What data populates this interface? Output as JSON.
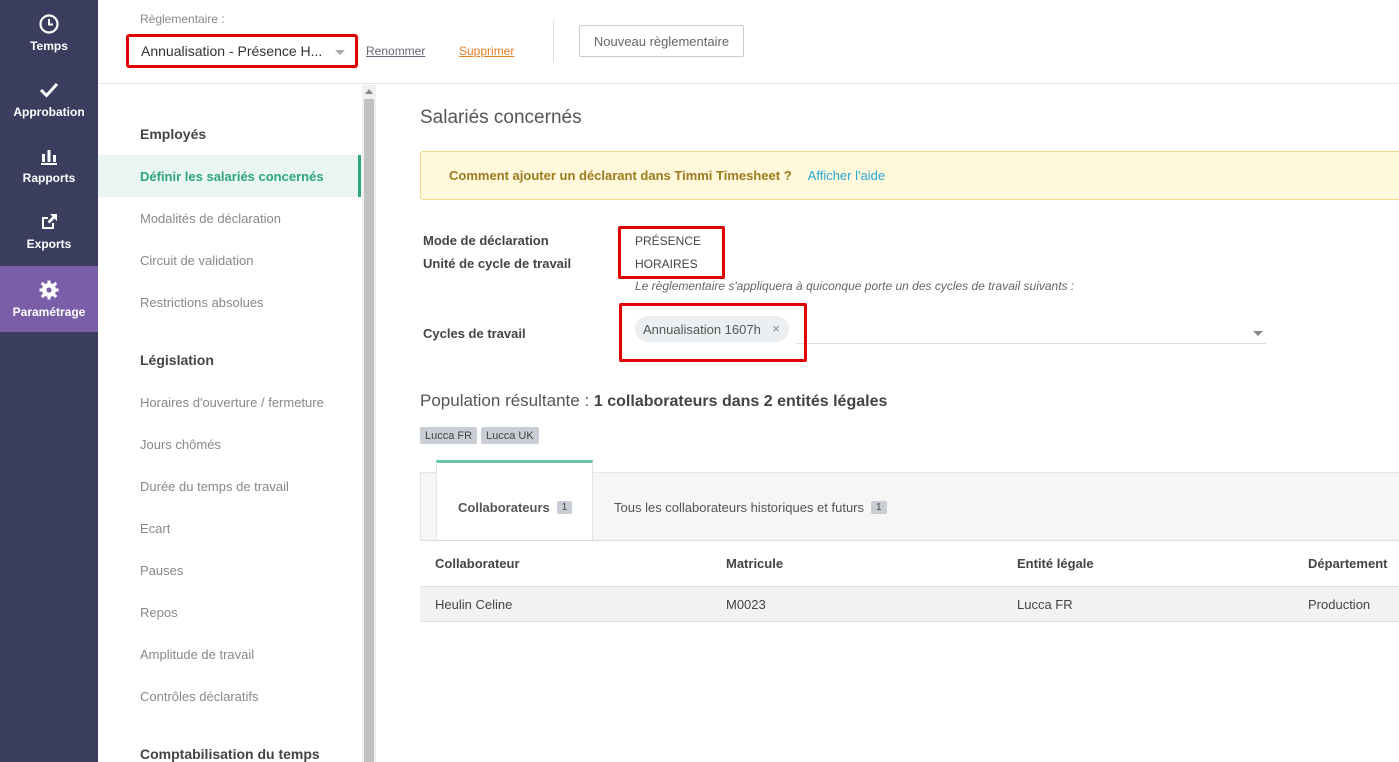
{
  "nav": {
    "items": [
      {
        "label": "Temps",
        "icon": "clock-icon"
      },
      {
        "label": "Approbation",
        "icon": "check-icon"
      },
      {
        "label": "Rapports",
        "icon": "bar-chart-icon"
      },
      {
        "label": "Exports",
        "icon": "export-icon"
      },
      {
        "label": "Paramétrage",
        "icon": "gear-icon",
        "active": true
      }
    ]
  },
  "header": {
    "reg_label": "Règlementaire :",
    "reg_value": "Annualisation - Présence H...",
    "rename": "Renommer",
    "delete": "Supprimer",
    "new_button": "Nouveau règlementaire"
  },
  "sidemenu": {
    "sections": [
      {
        "title": "Employés",
        "items": [
          "Définir les salariés concernés",
          "Modalités de déclaration",
          "Circuit de validation",
          "Restrictions absolues"
        ]
      },
      {
        "title": "Législation",
        "items": [
          "Horaires d'ouverture / fermeture",
          "Jours chômés",
          "Durée du temps de travail",
          "Ecart",
          "Pauses",
          "Repos",
          "Amplitude de travail",
          "Contrôles déclaratifs"
        ]
      },
      {
        "title": "Comptabilisation du temps",
        "items": []
      }
    ]
  },
  "main": {
    "title": "Salariés concernés",
    "help_question": "Comment ajouter un déclarant dans Timmi Timesheet ?",
    "help_link": "Afficher l'aide",
    "mode_label": "Mode de déclaration",
    "mode_value": "PRÉSENCE",
    "unit_label": "Unité de cycle de travail",
    "unit_value": "HORAIRES",
    "hint": "Le règlementaire s'appliquera à quiconque porte un des cycles de travail suivants :",
    "cycles_label": "Cycles de travail",
    "cycle_chip": "Annualisation 1607h",
    "cycle_remove": "×",
    "population_prefix": "Population résultante :",
    "population_value": "1 collaborateurs dans 2 entités légales",
    "entities": [
      "Lucca FR",
      "Lucca UK"
    ],
    "tabs": [
      {
        "label": "Collaborateurs",
        "count": "1"
      },
      {
        "label": "Tous les collaborateurs historiques et futurs",
        "count": "1"
      }
    ],
    "table": {
      "headers": [
        "Collaborateur",
        "Matricule",
        "Entité légale",
        "Département"
      ],
      "rows": [
        [
          "Heulin Celine",
          "M0023",
          "Lucca FR",
          "Production"
        ]
      ]
    }
  },
  "colors": {
    "nav_bg": "#3b3d5e",
    "nav_active": "#7a5ea8",
    "accent_green": "#2fa57f",
    "highlight_red": "#e00000"
  }
}
